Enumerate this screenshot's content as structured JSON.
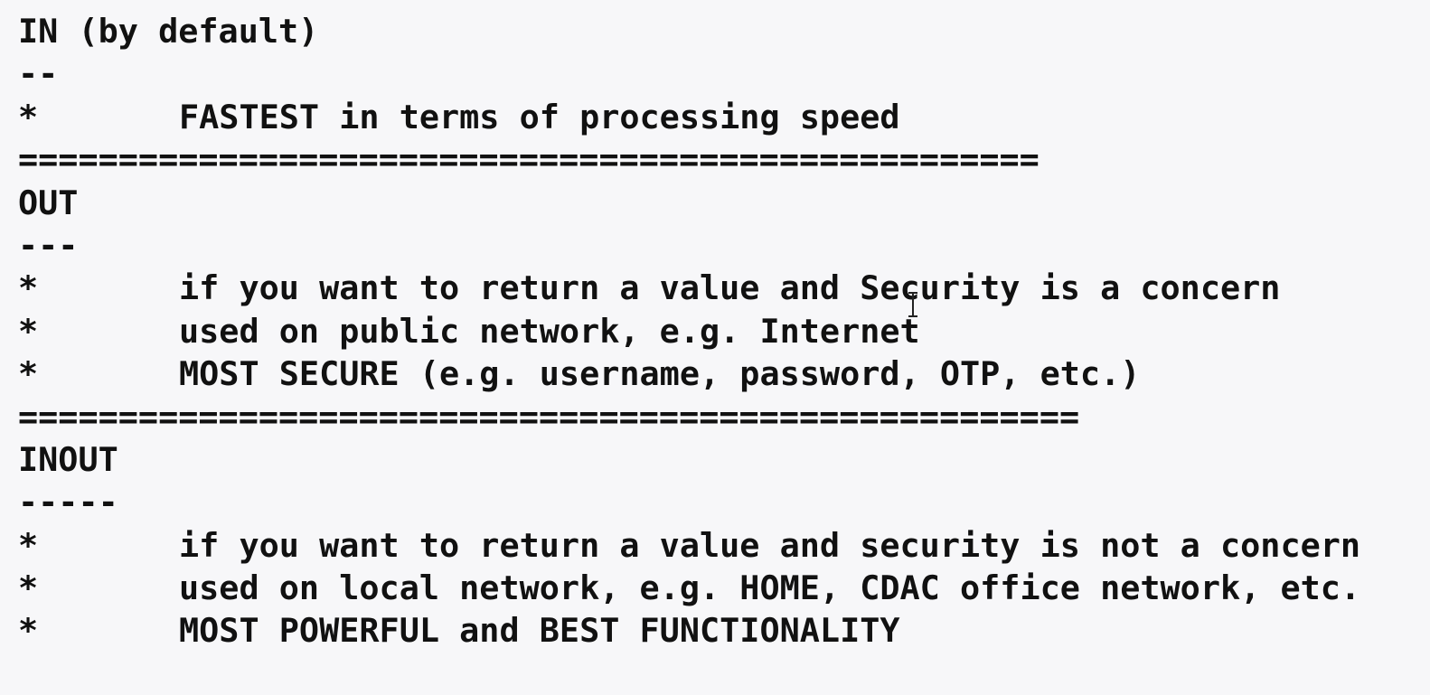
{
  "sections": [
    {
      "heading": "IN (by default)",
      "underline": "--",
      "bullets": [
        {
          "marker": "*",
          "text": "FASTEST in terms of processing speed"
        }
      ],
      "separator": "==================================================="
    },
    {
      "heading": "OUT",
      "underline": "---",
      "bullets": [
        {
          "marker": "*",
          "text": "if you want to return a value and Security is a concern"
        },
        {
          "marker": "*",
          "text": "used on public network, e.g. Internet"
        },
        {
          "marker": "*",
          "text": "MOST SECURE (e.g. username, password, OTP, etc.)"
        }
      ],
      "separator": "====================================================="
    },
    {
      "heading": "INOUT",
      "underline": "-----",
      "bullets": [
        {
          "marker": "*",
          "text": "if you want to return a value and security is not a concern"
        },
        {
          "marker": "*",
          "text": "used on local network, e.g. HOME, CDAC office network, etc."
        },
        {
          "marker": "*",
          "text": "MOST POWERFUL and BEST FUNCTIONALITY"
        }
      ]
    }
  ],
  "cursor_icon": "text-cursor-icon"
}
